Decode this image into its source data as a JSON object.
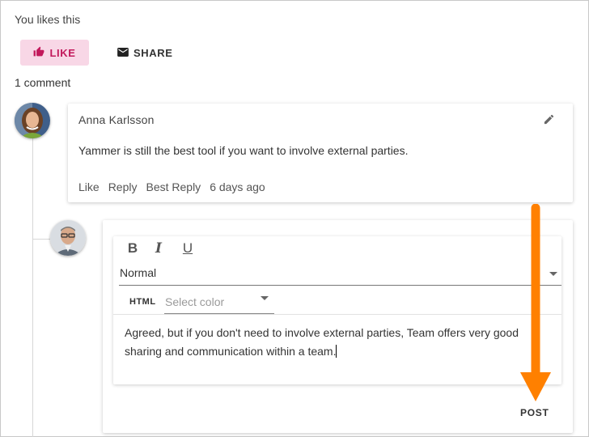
{
  "reactions": {
    "likes_text": "You likes this",
    "like_label": "LIKE",
    "share_label": "SHARE",
    "comment_count": "1 comment"
  },
  "comment": {
    "author": "Anna Karlsson",
    "text": "Yammer is still the best tool if you want to involve external parties.",
    "actions": [
      "Like",
      "Reply",
      "Best Reply"
    ],
    "time": "6 days ago"
  },
  "reply_editor": {
    "style_value": "Normal",
    "html_label": "HTML",
    "color_placeholder": "Select color",
    "text": "Agreed, but if you don't need to involve external parties, Team offers very good sharing and communication within a team.",
    "post_label": "POST"
  },
  "colors": {
    "like_bg": "#f8d7e6",
    "like_fg": "#c2185b",
    "annotation_arrow": "#ff8000"
  },
  "icons": [
    "thumbs-up-icon",
    "envelope-icon",
    "pencil-icon",
    "bold-icon",
    "italic-icon",
    "underline-icon",
    "chevron-down-icon",
    "arrow-down-icon"
  ]
}
